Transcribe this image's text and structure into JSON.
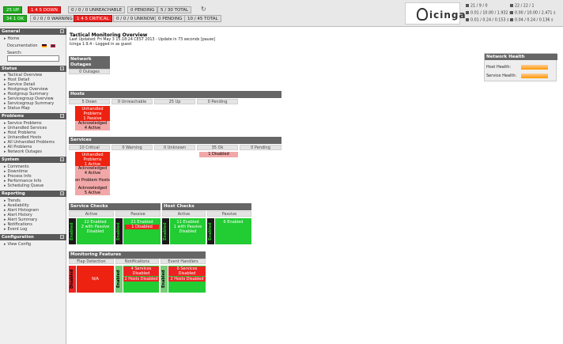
{
  "topbar": {
    "hosts_up": "25 UP",
    "hosts_down_a": "1",
    "hosts_down_b": "4",
    "hosts_down_c": "5 DOWN",
    "hosts_unreach": "0 / 0 / 0 UNREACHABLE",
    "hosts_pending": "0 PENDING",
    "hosts_total": "5 / 30 TOTAL",
    "svc_ok": "34",
    "svc_ok_label": "1 OK",
    "svc_warn": "0 / 0 / 0 WARNING",
    "svc_crit_a": "1",
    "svc_crit_b": "4",
    "svc_crit_c": "5 CRITICAL",
    "svc_unknown": "0 / 0 / 0 UNKNOWN",
    "svc_pending": "0 PENDING",
    "svc_total": "10 / 45 TOTAL"
  },
  "logo": "icinga",
  "stats": [
    "21 / 9 / 0",
    "0.01 / 10.00 / 1.932 s",
    "0.01 / 0.24 / 0.153 s",
    "22 / 22 / 1",
    "0.00 / 10.00 / 2.471 s",
    "0.04 / 0.24 / 0.136 s"
  ],
  "sidebar": {
    "general": "General",
    "home": "Home",
    "documentation": "Documentation",
    "search": "Search:",
    "status": "Status",
    "status_items": [
      "Tactical Overview",
      "Host Detail",
      "Service Detail",
      "Hostgroup Overview",
      "Hostgroup Summary",
      "Servicegroup Overview",
      "Servicegroup Summary",
      "Status Map"
    ],
    "problems": "Problems",
    "problem_items": [
      "Service Problems",
      "Unhandled Services",
      "Host Problems",
      "Unhandled Hosts",
      "All Unhandled Problems",
      "All Problems",
      "Network Outages"
    ],
    "system": "System",
    "system_items": [
      "Comments",
      "Downtime",
      "Process Info",
      "Performance Info",
      "Scheduling Queue"
    ],
    "reporting": "Reporting",
    "reporting_items": [
      "Trends",
      "Availability",
      "Alert Histogram",
      "Alert History",
      "Alert Summary",
      "Notifications",
      "Event Log"
    ],
    "configuration": "Configuration",
    "config_items": [
      "View Config"
    ]
  },
  "main": {
    "title": "Tactical Monitoring Overview",
    "updated": "Last Updated: Fri May 3 15:18:24 CEST 2013 - Update in 73 seconds [pause]",
    "version": "Icinga 1.9.4 - Logged in as guest",
    "outages_title": "Network Outages",
    "outages": "0 Outages",
    "hosts_title": "Hosts",
    "hosts_cols": [
      "5 Down",
      "0 Unreachable",
      "25 Up",
      "0 Pending"
    ],
    "hosts_unhandled": [
      "Unhandled",
      "Problems",
      "1 Passive"
    ],
    "hosts_ack": [
      "Acknowledged",
      "4 Active"
    ],
    "services_title": "Services",
    "services_cols": [
      "10 Critical",
      "0 Warning",
      "0 Unknown",
      "35 Ok",
      "0 Pending"
    ],
    "svc_unhandled": [
      "Unhandled",
      "Problems",
      "1 Active"
    ],
    "svc_ack1": [
      "Acknowledged",
      "4 Active"
    ],
    "svc_onprob": "on Problem Hosts",
    "svc_ack2": [
      "Acknowledged",
      "5 Active"
    ],
    "svc_ok_disabled": "1 Disabled",
    "svc_checks_title": "Service Checks",
    "host_checks_title": "Host Checks",
    "active": "Active",
    "passive": "Passive",
    "enabled": "Enabled",
    "svc_active": [
      "22 Enabled",
      "2 with Passive",
      "Disabled"
    ],
    "svc_passive": [
      "21 Enabled",
      "1 Disabled"
    ],
    "host_active": [
      "11 Enabled",
      "1 with Passive",
      "Disabled"
    ],
    "host_passive": [
      "6 Enabled"
    ],
    "mon_title": "Monitoring Features",
    "mon_cols": [
      "Flap Detection",
      "Notifications",
      "Event Handlers"
    ],
    "disabled": "Disabled",
    "na": "N/A",
    "notif": [
      "4 Services",
      "Disabled",
      "2 Hosts Disabled"
    ],
    "evh": [
      "6 Services",
      "Disabled",
      "2 Hosts Disabled"
    ]
  },
  "health": {
    "title": "Network Health",
    "host": "Host Health:",
    "service": "Service Health:"
  }
}
